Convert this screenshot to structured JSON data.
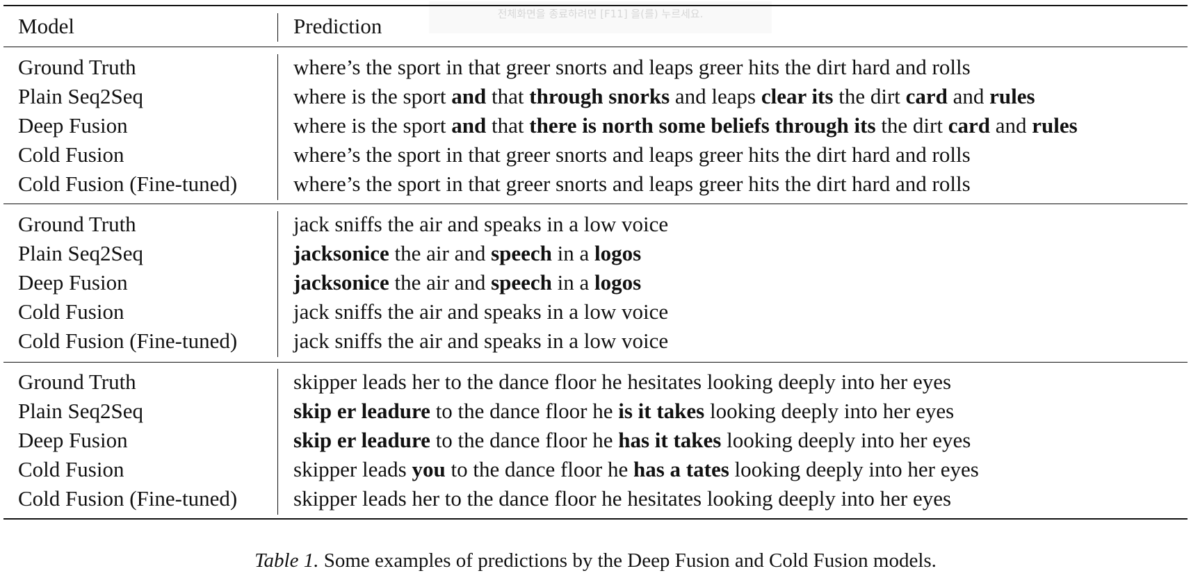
{
  "overlay_text": "전체화면을 종료하려면 [F11] 을(를) 누르세요.",
  "table": {
    "headers": [
      "Model",
      "Prediction"
    ],
    "groups": [
      [
        {
          "model": "Ground Truth",
          "prediction": [
            [
              "where’s the sport in that greer snorts and leaps greer hits the dirt hard and rolls",
              false
            ]
          ]
        },
        {
          "model": "Plain Seq2Seq",
          "prediction": [
            [
              "where is the sport ",
              false
            ],
            [
              "and",
              true
            ],
            [
              " that ",
              false
            ],
            [
              "through snorks",
              true
            ],
            [
              " and leaps ",
              false
            ],
            [
              "clear its",
              true
            ],
            [
              " the dirt ",
              false
            ],
            [
              "card",
              true
            ],
            [
              " and ",
              false
            ],
            [
              "rules",
              true
            ]
          ]
        },
        {
          "model": "Deep Fusion",
          "prediction": [
            [
              "where is the sport ",
              false
            ],
            [
              "and",
              true
            ],
            [
              " that ",
              false
            ],
            [
              "there is north some beliefs through its",
              true
            ],
            [
              " the dirt ",
              false
            ],
            [
              "card",
              true
            ],
            [
              " and ",
              false
            ],
            [
              "rules",
              true
            ]
          ]
        },
        {
          "model": "Cold Fusion",
          "prediction": [
            [
              "where’s the sport in that greer snorts and leaps greer hits the dirt hard and rolls",
              false
            ]
          ]
        },
        {
          "model": "Cold Fusion (Fine-tuned)",
          "prediction": [
            [
              "where’s the sport in that greer snorts and leaps greer hits the dirt hard and rolls",
              false
            ]
          ]
        }
      ],
      [
        {
          "model": "Ground Truth",
          "prediction": [
            [
              "jack sniffs the air and speaks in a low voice",
              false
            ]
          ]
        },
        {
          "model": "Plain Seq2Seq",
          "prediction": [
            [
              "jacksonice",
              true
            ],
            [
              " the air and ",
              false
            ],
            [
              "speech",
              true
            ],
            [
              " in a ",
              false
            ],
            [
              "logos",
              true
            ]
          ]
        },
        {
          "model": "Deep Fusion",
          "prediction": [
            [
              "jacksonice",
              true
            ],
            [
              " the air and ",
              false
            ],
            [
              "speech",
              true
            ],
            [
              " in a ",
              false
            ],
            [
              "logos",
              true
            ]
          ]
        },
        {
          "model": "Cold Fusion",
          "prediction": [
            [
              "jack sniffs the air and speaks in a low voice",
              false
            ]
          ]
        },
        {
          "model": "Cold Fusion (Fine-tuned)",
          "prediction": [
            [
              "jack sniffs the air and speaks in a low voice",
              false
            ]
          ]
        }
      ],
      [
        {
          "model": "Ground Truth",
          "prediction": [
            [
              "skipper leads her to the dance floor he hesitates looking deeply into her eyes",
              false
            ]
          ]
        },
        {
          "model": "Plain Seq2Seq",
          "prediction": [
            [
              "skip er leadure",
              true
            ],
            [
              " to the dance floor he ",
              false
            ],
            [
              "is it takes",
              true
            ],
            [
              " looking deeply into her eyes",
              false
            ]
          ]
        },
        {
          "model": "Deep Fusion",
          "prediction": [
            [
              "skip er leadure",
              true
            ],
            [
              " to the dance floor he ",
              false
            ],
            [
              "has it takes",
              true
            ],
            [
              " looking deeply into her eyes",
              false
            ]
          ]
        },
        {
          "model": "Cold Fusion",
          "prediction": [
            [
              "skipper leads ",
              false
            ],
            [
              "you",
              true
            ],
            [
              " to the dance floor he ",
              false
            ],
            [
              "has a tates",
              true
            ],
            [
              " looking deeply into her eyes",
              false
            ]
          ]
        },
        {
          "model": "Cold Fusion (Fine-tuned)",
          "prediction": [
            [
              "skipper leads her to the dance floor he hesitates looking deeply into her eyes",
              false
            ]
          ]
        }
      ]
    ]
  },
  "caption": {
    "label": "Table 1.",
    "text": " Some examples of predictions by the Deep Fusion and Cold Fusion models."
  }
}
